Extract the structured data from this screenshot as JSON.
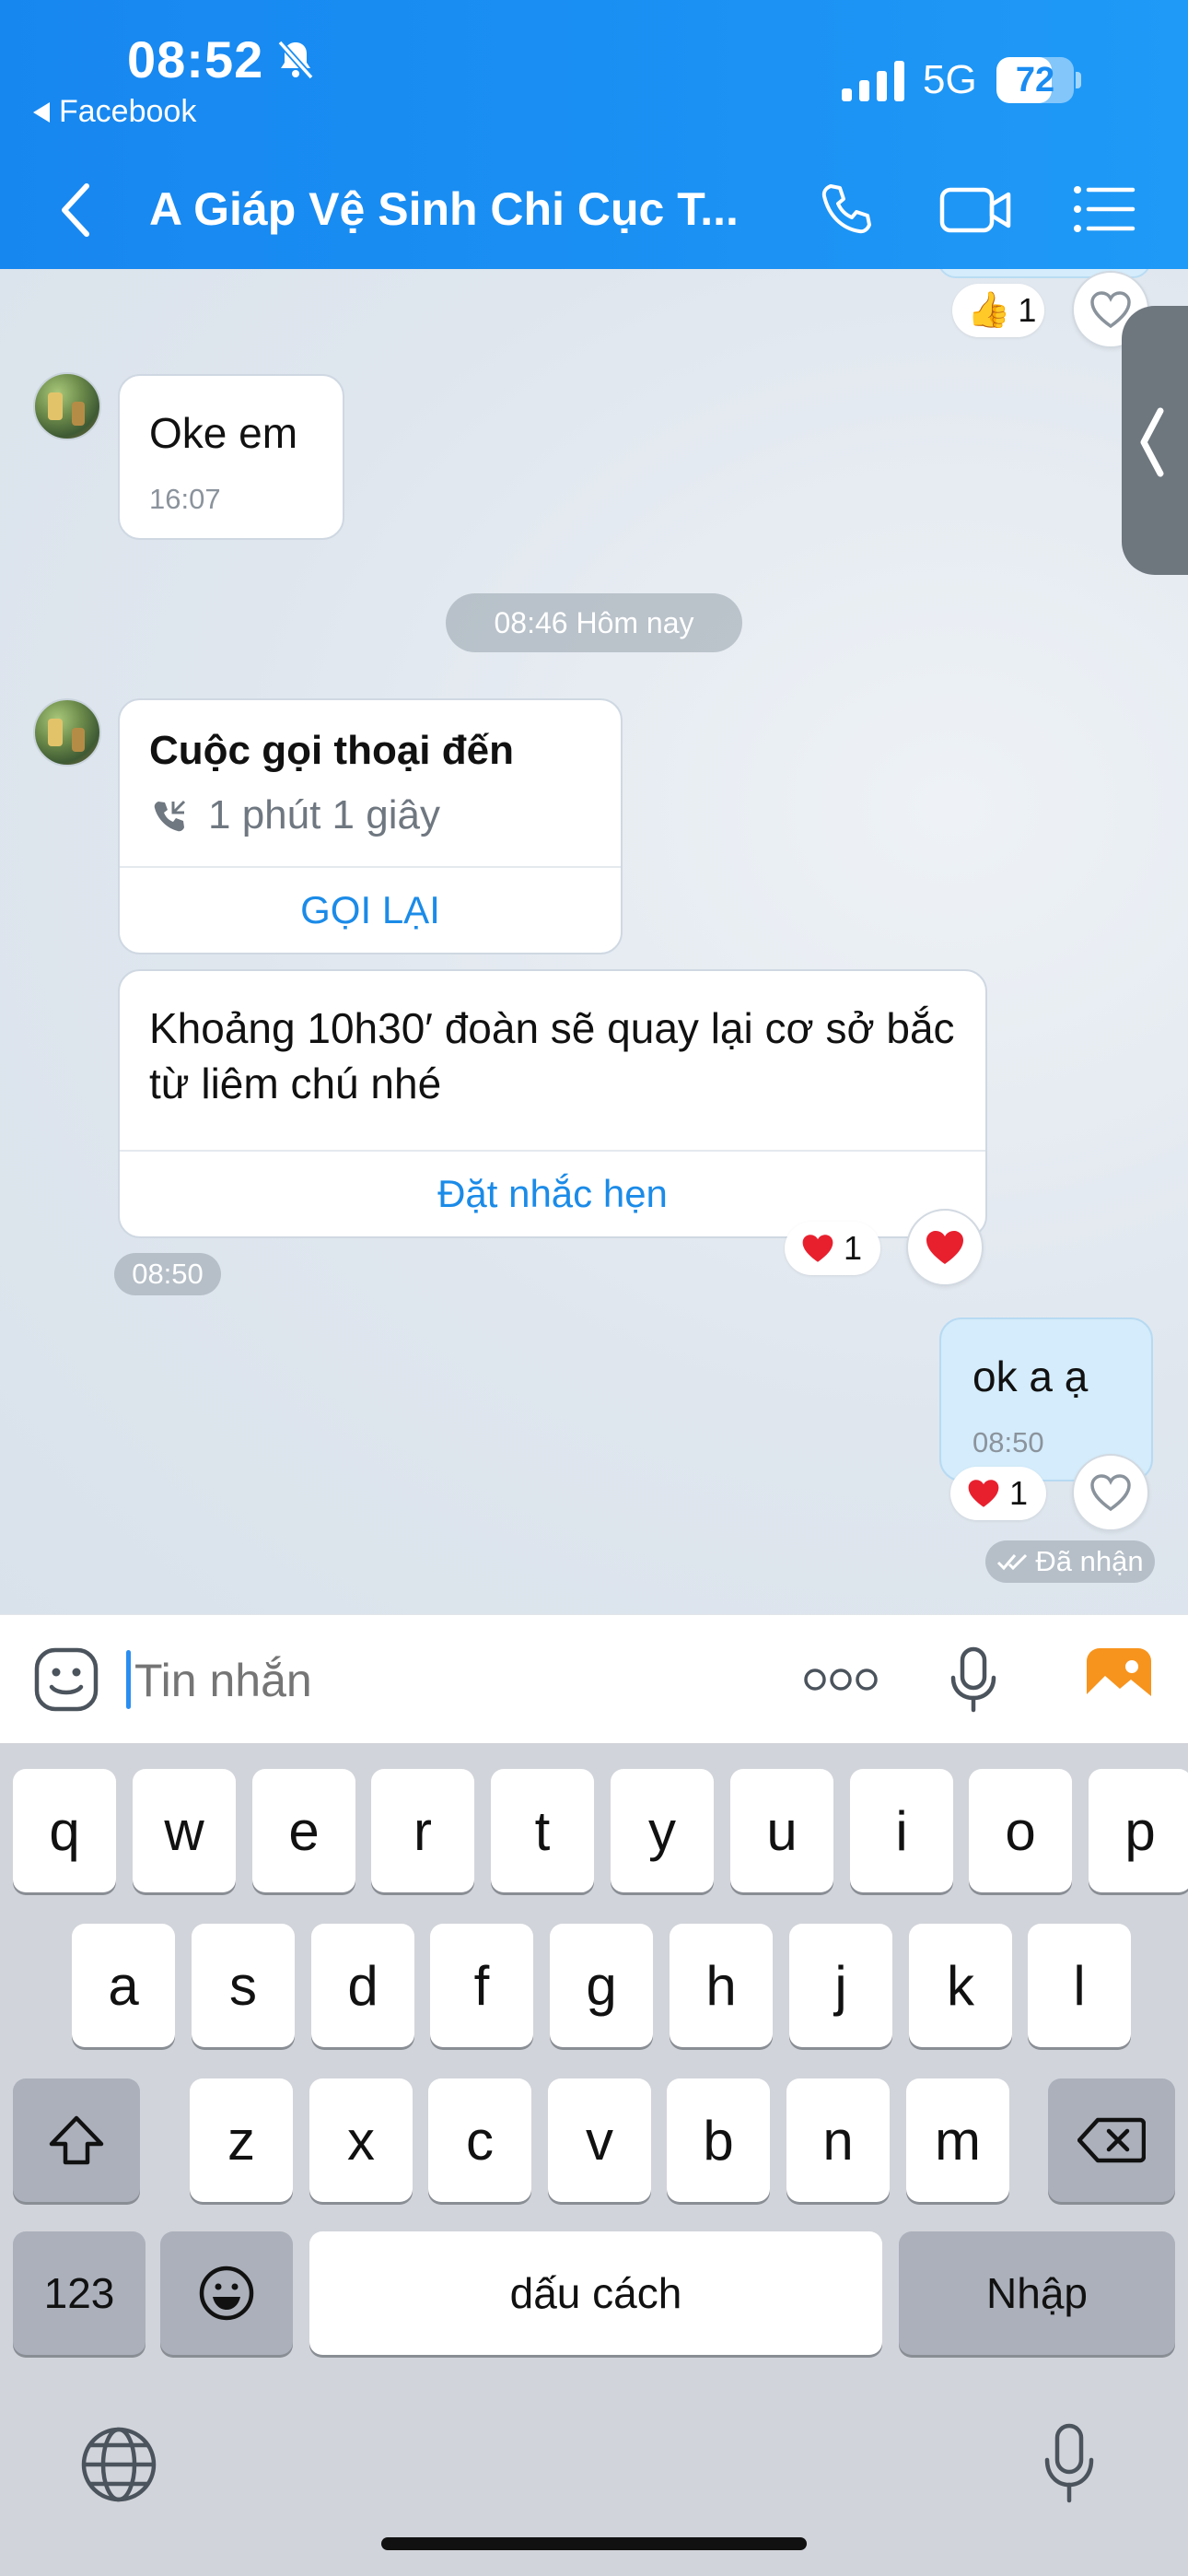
{
  "status_bar": {
    "time": "08:52",
    "back_app": "Facebook",
    "network": "5G",
    "battery": "72",
    "battery_level": 0.72
  },
  "header": {
    "title": "A Giáp Vệ Sinh Chi Cục T..."
  },
  "messages": {
    "prev_reaction_count": "1",
    "oke": {
      "text": "Oke em",
      "time": "16:07"
    },
    "divider": "08:46 Hôm nay",
    "call": {
      "title": "Cuộc gọi thoại đến",
      "duration": "1 phút 1 giây",
      "action": "GỌI LẠI"
    },
    "reminder": {
      "text": "Khoảng 10h30′ đoàn sẽ quay lại cơ sở bắc từ liêm chú nhé",
      "action": "Đặt nhắc hẹn",
      "time": "08:50",
      "reaction_count": "1"
    },
    "mine": {
      "text": "ok a ạ",
      "time": "08:50",
      "reaction_count": "1",
      "status": "Đã nhận"
    }
  },
  "input": {
    "placeholder": "Tin nhắn"
  },
  "keyboard": {
    "row1": [
      "q",
      "w",
      "e",
      "r",
      "t",
      "y",
      "u",
      "i",
      "o",
      "p"
    ],
    "row2": [
      "a",
      "s",
      "d",
      "f",
      "g",
      "h",
      "j",
      "k",
      "l"
    ],
    "row3": [
      "z",
      "x",
      "c",
      "v",
      "b",
      "n",
      "m"
    ],
    "numbers": "123",
    "space": "dấu cách",
    "return": "Nhập"
  },
  "colors": {
    "header": "#1a8ff3",
    "accent": "#1b8be8",
    "my_bubble": "#d4ecfb",
    "heart": "#e8202e"
  },
  "icons": [
    "bell-slash-icon",
    "signal-icon",
    "back-chevron-icon",
    "phone-icon",
    "video-icon",
    "list-menu-icon",
    "heart-icon",
    "thumbs-up-icon",
    "sticker-icon",
    "more-icon",
    "mic-icon",
    "photo-icon",
    "shift-icon",
    "backspace-icon",
    "emoji-icon",
    "globe-icon"
  ]
}
